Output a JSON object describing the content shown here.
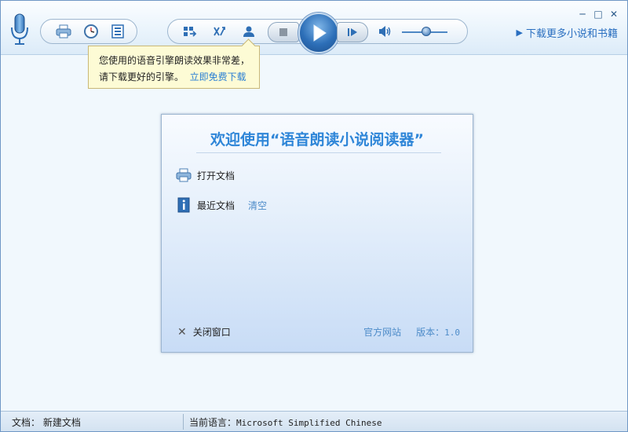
{
  "toolbar": {
    "download_link": "下载更多小说和书籍",
    "minimize": "─",
    "maximize": "□",
    "close": "✕"
  },
  "tooltip": {
    "line1": "您使用的语音引擎朗读效果非常差，",
    "line2": "请下载更好的引擎。",
    "link": "立即免费下载"
  },
  "dialog": {
    "title": "欢迎使用“语音朗读小说阅读器”",
    "open_doc": "打开文档",
    "recent_docs": "最近文档",
    "clear": "清空",
    "close_window": "关闭窗口",
    "official_site": "官方网站",
    "version_label": "版本：",
    "version": "1.0"
  },
  "status": {
    "doc_label": "文档：",
    "doc_value": "新建文档",
    "lang_label": "当前语言：",
    "lang_value": "Microsoft Simplified Chinese"
  },
  "colors": {
    "accent": "#2f86d8",
    "link": "#2a6fc0",
    "tooltip_bg": "#fdfbd5"
  },
  "volume": 0.5
}
